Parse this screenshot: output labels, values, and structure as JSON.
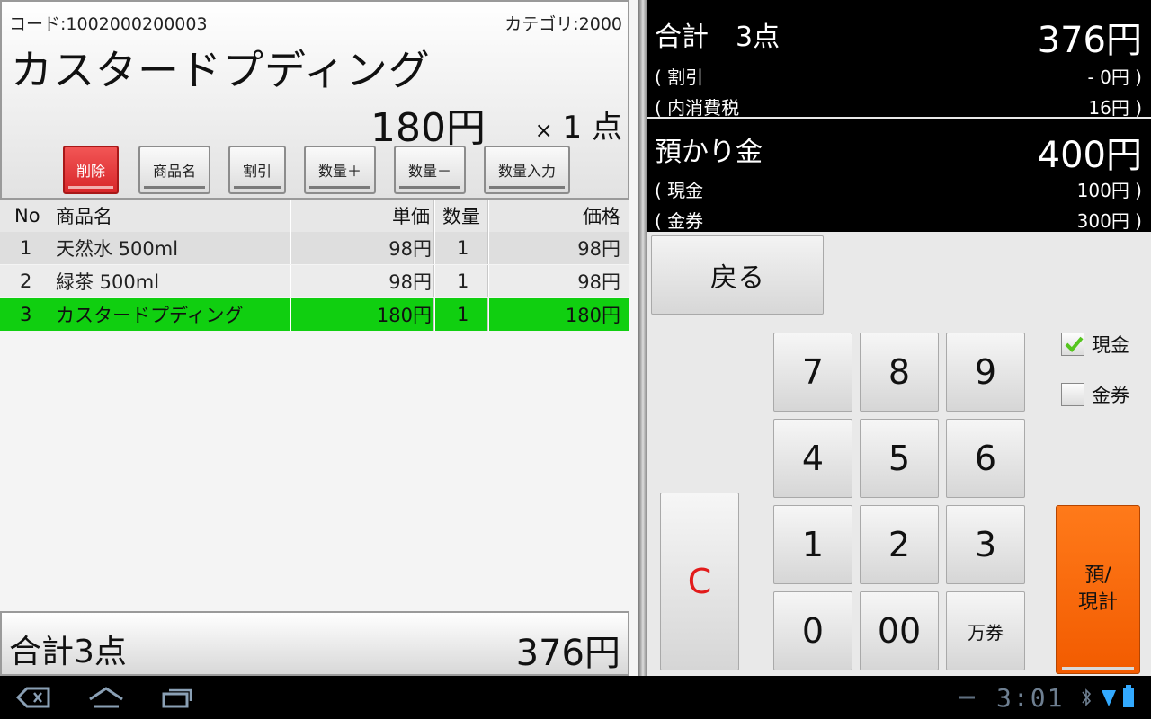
{
  "product": {
    "code": "コード:1002000200003",
    "category": "カテゴリ:2000",
    "name": "カスタードプディング",
    "price": "180円",
    "qty_prefix": "×",
    "qty_value": "1",
    "qty_suffix": "点"
  },
  "actions": {
    "delete": "削除",
    "product_name": "商品名",
    "discount": "割引",
    "qty_plus": "数量＋",
    "qty_minus": "数量－",
    "qty_input": "数量入力"
  },
  "list": {
    "headers": {
      "no": "No",
      "name": "商品名",
      "unit_price": "単価",
      "qty": "数量",
      "price": "価格"
    },
    "rows": [
      {
        "no": "1",
        "name": "天然水 500ml",
        "unit_price": "98円",
        "qty": "1",
        "price": "98円"
      },
      {
        "no": "2",
        "name": "緑茶 500ml",
        "unit_price": "98円",
        "qty": "1",
        "price": "98円"
      },
      {
        "no": "3",
        "name": "カスタードプディング",
        "unit_price": "180円",
        "qty": "1",
        "price": "180円"
      }
    ],
    "selected_row": 3
  },
  "footer": {
    "total_label": "合計3点",
    "total_value": "376円"
  },
  "summary": {
    "total_label": "合計　3点",
    "total_value": "376円",
    "discount_label": "( 割引",
    "discount_value": "- 0円 )",
    "tax_label": "( 内消費税",
    "tax_value": "16円 )"
  },
  "deposit": {
    "label": "預かり金",
    "value": "400円",
    "cash_label": "( 現金",
    "cash_value": "100円 )",
    "voucher_label": "( 金券",
    "voucher_value": "300円 )"
  },
  "keypad": {
    "back": "戻る",
    "keys": [
      "7",
      "8",
      "9",
      "4",
      "5",
      "6",
      "1",
      "2",
      "3",
      "0",
      "00",
      "万券"
    ],
    "clear": "C",
    "pay_line1": "預/",
    "pay_line2": "現計"
  },
  "payment_types": {
    "cash": {
      "label": "現金",
      "checked": true
    },
    "voucher": {
      "label": "金券",
      "checked": false
    }
  },
  "system": {
    "clock": "3:01"
  },
  "colors": {
    "selected_row": "#10cf10",
    "pay_button": "#f25b00",
    "delete_button": "#d8272a",
    "clear_text": "#e21b1b"
  }
}
